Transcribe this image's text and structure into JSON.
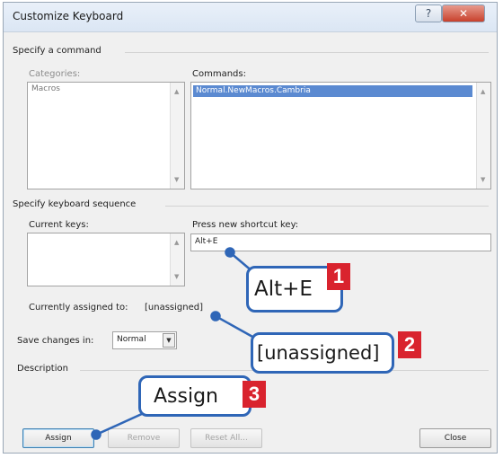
{
  "window": {
    "title": "Customize Keyboard",
    "help_icon": "?",
    "close_icon": "✕"
  },
  "command": {
    "heading": "Specify a command",
    "categories_label": "Categories:",
    "categories": [
      "Macros"
    ],
    "commands_label": "Commands:",
    "commands": [
      "Normal.NewMacros.Cambria"
    ]
  },
  "keyboard": {
    "heading": "Specify keyboard sequence",
    "current_keys_label": "Current keys:",
    "press_label": "Press new shortcut key:",
    "press_value": "Alt+E"
  },
  "assigned": {
    "label": "Currently assigned to:",
    "value": "[unassigned]"
  },
  "save": {
    "label": "Save changes in:",
    "value": "Normal"
  },
  "description": {
    "label": "Description"
  },
  "buttons": {
    "assign": "Assign",
    "remove": "Remove",
    "reset_all": "Reset All...",
    "close": "Close"
  },
  "callouts": [
    {
      "text": "Alt+E",
      "number": "1"
    },
    {
      "text": "[unassigned]",
      "number": "2"
    },
    {
      "text": "Assign",
      "number": "3"
    }
  ],
  "colors": {
    "callout_border": "#2f66b7",
    "badge": "#d9232e",
    "selection": "#5b8ad1"
  }
}
